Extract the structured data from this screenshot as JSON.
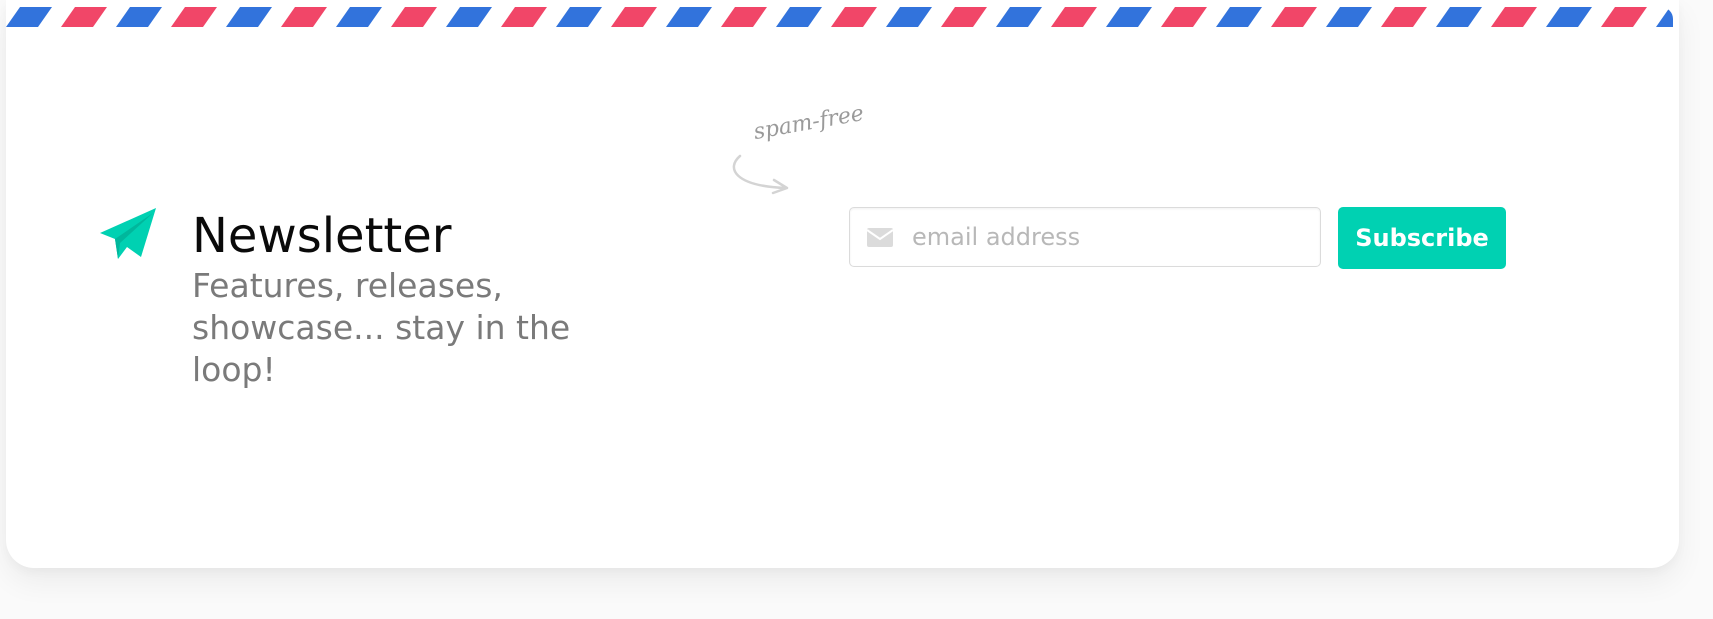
{
  "colors": {
    "accent": "#00d1b2",
    "stripe_blue": "#3273dc",
    "stripe_red": "#f14668",
    "title": "#0a0a0a",
    "subtitle": "#7a7a7a"
  },
  "newsletter": {
    "icon": "paper-plane-icon",
    "title": "Newsletter",
    "subtitle": "Features, releases, showcase... stay in the loop!"
  },
  "note": {
    "text": "spam-free",
    "icon": "curved-arrow-icon"
  },
  "form": {
    "email_icon": "envelope-icon",
    "email_placeholder": "email address",
    "email_value": "",
    "submit_label": "Subscribe"
  }
}
